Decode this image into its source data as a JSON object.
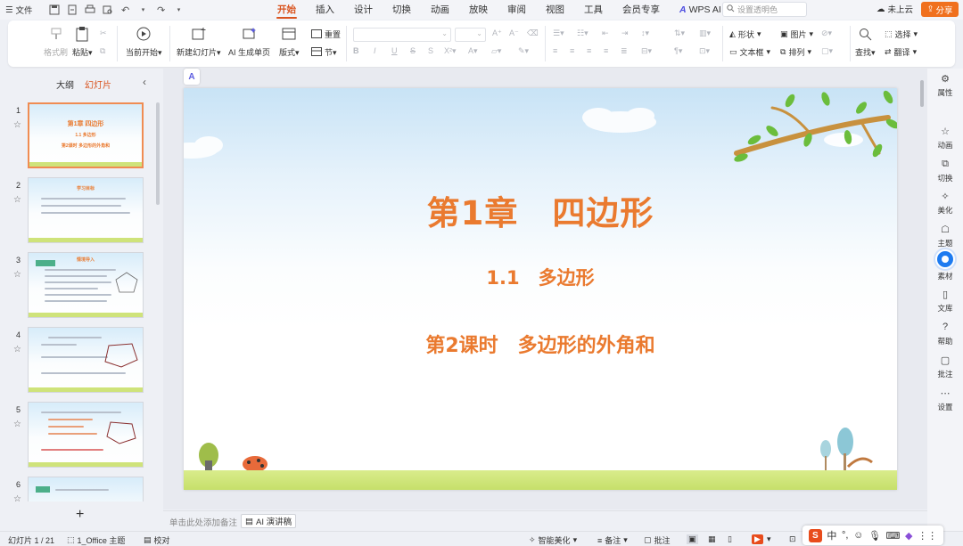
{
  "topbar": {
    "file_label": "文件",
    "tabs": [
      "开始",
      "插入",
      "设计",
      "切换",
      "动画",
      "放映",
      "审阅",
      "视图",
      "工具",
      "会员专享",
      "WPS AI"
    ],
    "active_tab": "开始",
    "search_placeholder": "设置透明色",
    "cloud_label": "未上云",
    "share_label": "分享"
  },
  "ribbon": {
    "format_painter": "格式刷",
    "paste": "粘贴",
    "play_from_start": "当前开始",
    "new_slide": "新建幻灯片",
    "ai_generate": "AI 生成单页",
    "layout": "版式",
    "reset": "重置",
    "section": "节",
    "shape": "形状",
    "picture": "图片",
    "textbox": "文本框",
    "arrange": "排列",
    "find": "查找",
    "select": "选择",
    "translate": "翻译"
  },
  "left_panel": {
    "tab_outline": "大纲",
    "tab_slides": "幻灯片",
    "active_tab": "幻灯片",
    "thumbnails": [
      {
        "num": "1",
        "lines": [
          "第1章  四边形",
          "1.1 多边形",
          "第2课时  多边形的外角和"
        ]
      },
      {
        "num": "2",
        "header": "学习目标"
      },
      {
        "num": "3",
        "header": "情境导入"
      },
      {
        "num": "4"
      },
      {
        "num": "5"
      },
      {
        "num": "6"
      }
    ]
  },
  "slide": {
    "chapter": "第1章　四边形",
    "section": "1.1　多边形",
    "lesson": "第2课时　多边形的外角和"
  },
  "notes": {
    "placeholder": "单击此处添加备注",
    "ai_script": "AI 演讲稿"
  },
  "right_panel": [
    "属性",
    "动画",
    "切换",
    "美化",
    "主题",
    "素材",
    "文库",
    "帮助",
    "批注",
    "设置"
  ],
  "status": {
    "slide_counter": "幻灯片 1 / 21",
    "theme": "1_Office 主题",
    "proofread": "校对",
    "smart_beautify": "智能美化",
    "notes": "备注",
    "comments": "批注"
  },
  "ime": {
    "logo": "S",
    "lang": "中",
    "punct": "°,"
  },
  "colors": {
    "accent": "#d9531e",
    "title": "#ea7a2f",
    "share": "#f0701e",
    "ground": "#c6df6a"
  }
}
